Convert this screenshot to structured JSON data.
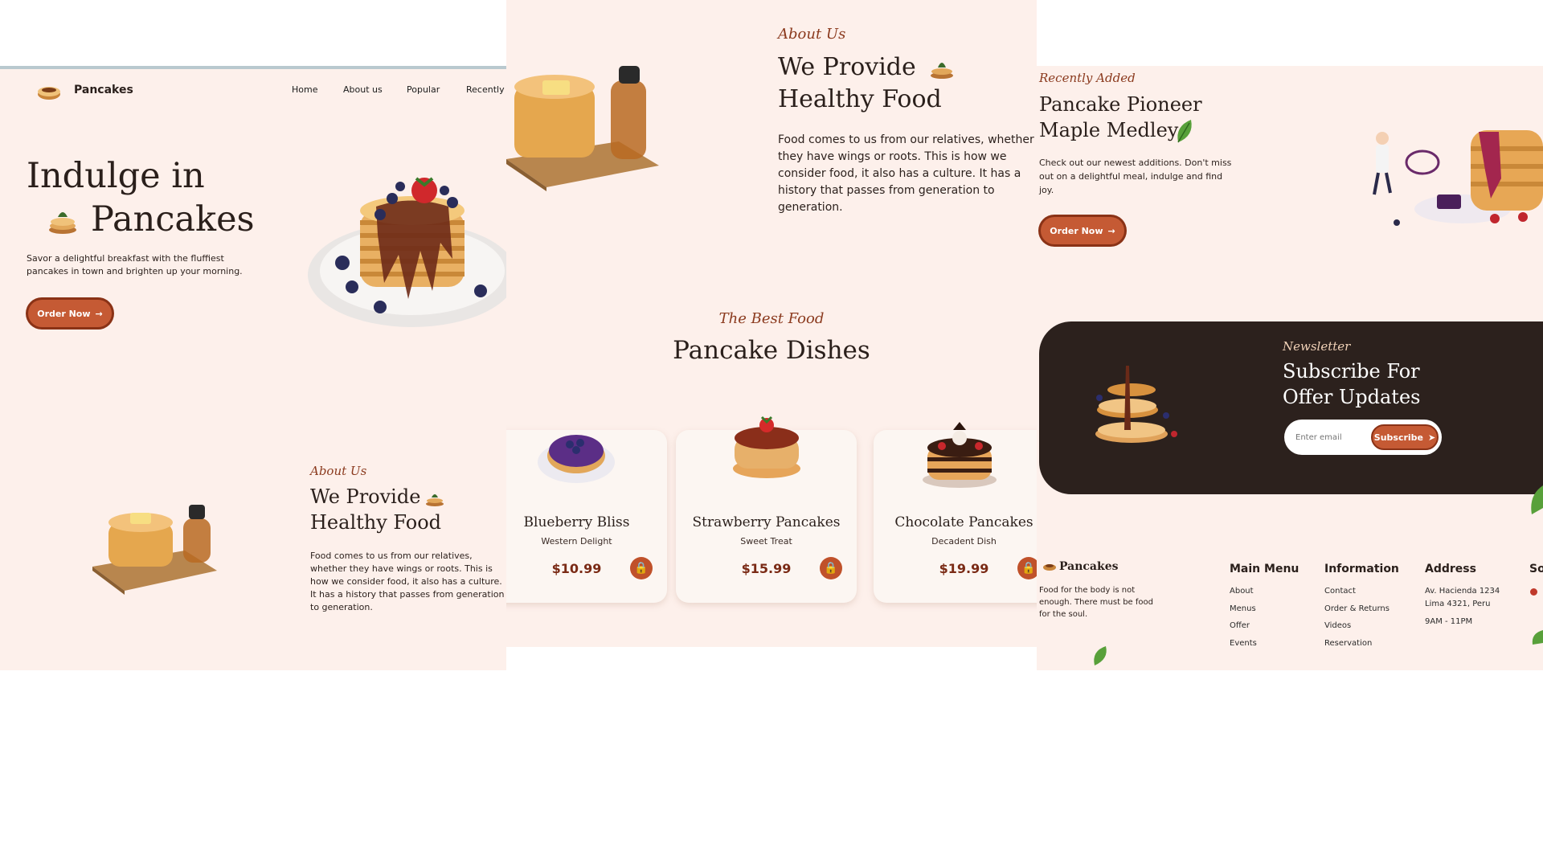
{
  "brand": "Pancakes",
  "nav": [
    "Home",
    "About us",
    "Popular",
    "Recently"
  ],
  "hero": {
    "title_line1": "Indulge in",
    "title_line2": "Pancakes",
    "description": "Savor a delightful breakfast with the fluffiest pancakes in town and brighten up your morning.",
    "cta": "Order Now"
  },
  "about": {
    "label": "About Us",
    "title_line1": "We Provide",
    "title_line2": "Healthy Food",
    "text": "Food comes to us from our relatives, whether they have wings or roots. This is how we consider food, it also has a culture. It has a history that passes from generation to generation."
  },
  "popular": {
    "label": "The Best Food",
    "title": "Pancake Dishes",
    "cards": [
      {
        "name": "Blueberry Bliss",
        "subtitle": "Western Delight",
        "price": "$10.99"
      },
      {
        "name": "Strawberry Pancakes",
        "subtitle": "Sweet Treat",
        "price": "$15.99"
      },
      {
        "name": "Chocolate Pancakes",
        "subtitle": "Decadent Dish",
        "price": "$19.99"
      }
    ]
  },
  "recent": {
    "label": "Recently Added",
    "title_line1": "Pancake Pioneer",
    "title_line2": "Maple Medley",
    "text": "Check out our newest additions. Don't miss out on a delightful meal, indulge and find joy.",
    "cta": "Order Now"
  },
  "newsletter": {
    "label": "Newsletter",
    "title_line1": "Subscribe For",
    "title_line2": "Offer Updates",
    "placeholder": "Enter email",
    "button": "Subscribe"
  },
  "footer": {
    "brand": "Pancakes",
    "tagline": "Food for the body is not enough. There must be food for the soul.",
    "main_menu": {
      "title": "Main Menu",
      "items": [
        "About",
        "Menus",
        "Offer",
        "Events"
      ]
    },
    "information": {
      "title": "Information",
      "items": [
        "Contact",
        "Order & Returns",
        "Videos",
        "Reservation"
      ]
    },
    "address": {
      "title": "Address",
      "line1": "Av. Hacienda 1234",
      "line2": "Lima 4321, Peru",
      "hours": "9AM - 11PM"
    },
    "social_title_partial": "So"
  },
  "colors": {
    "background": "#fdf0eb",
    "accent": "#c55a34",
    "dark": "#2c211d",
    "script": "#8b3a1e"
  }
}
